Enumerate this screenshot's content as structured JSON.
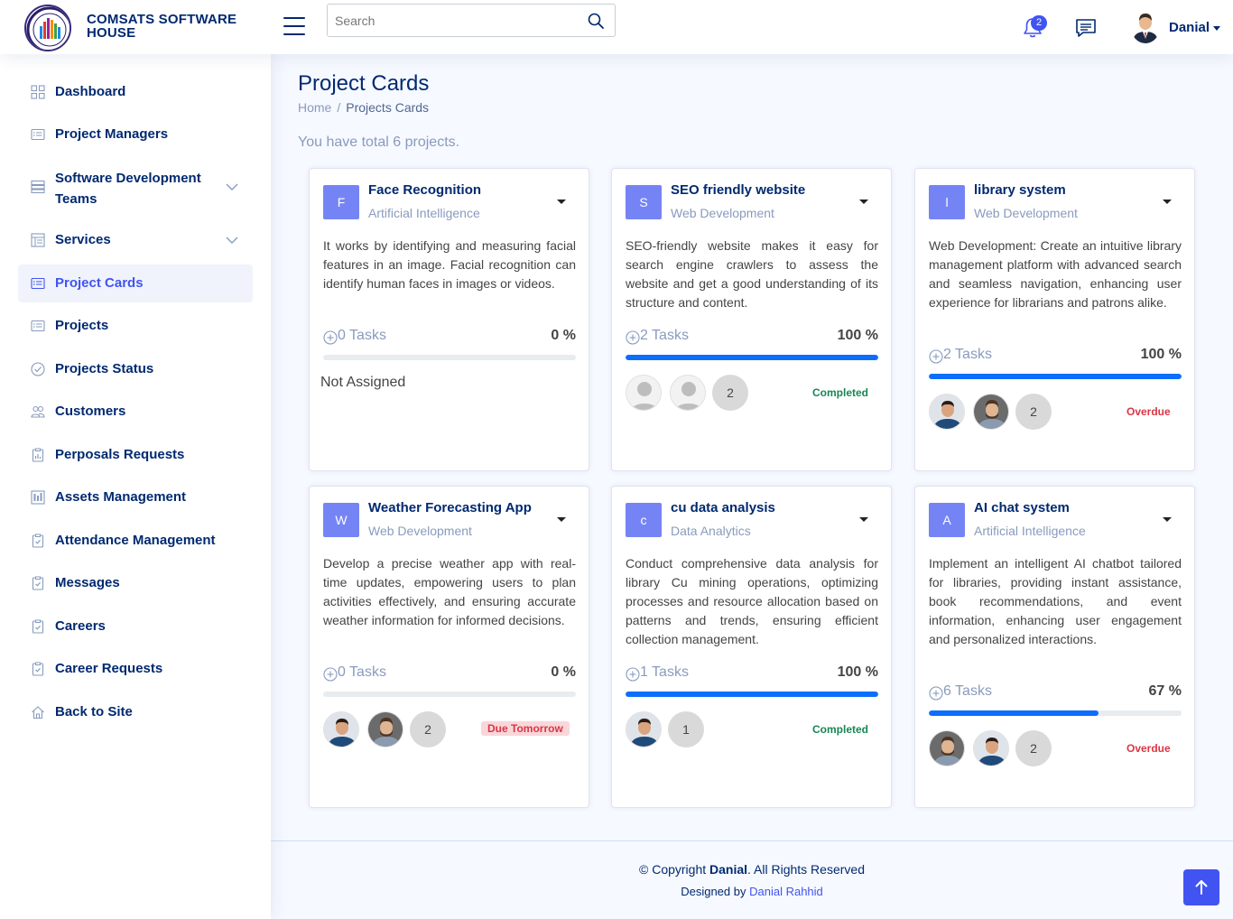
{
  "header": {
    "brand_line1": "COMSATS SOFTWARE",
    "brand_line2": "HOUSE",
    "search_placeholder": "Search",
    "notification_count": "2",
    "user_name": "Danial"
  },
  "sidebar": {
    "items": [
      {
        "label": "Dashboard",
        "icon": "grid-icon"
      },
      {
        "label": "Project Managers",
        "icon": "card-list-icon"
      },
      {
        "label": "Software Development Teams",
        "icon": "layers-icon",
        "expandable": true
      },
      {
        "label": "Services",
        "icon": "layout-icon",
        "expandable": true
      },
      {
        "label": "Project Cards",
        "icon": "card-list-icon",
        "active": true
      },
      {
        "label": "Projects",
        "icon": "card-list-icon"
      },
      {
        "label": "Projects Status",
        "icon": "check-circle-icon"
      },
      {
        "label": "Customers",
        "icon": "people-icon"
      },
      {
        "label": "Perposals Requests",
        "icon": "clipboard-data-icon"
      },
      {
        "label": "Assets Management",
        "icon": "bar-chart-icon"
      },
      {
        "label": "Attendance Management",
        "icon": "clipboard-check-icon"
      },
      {
        "label": "Messages",
        "icon": "clipboard-check-icon"
      },
      {
        "label": "Careers",
        "icon": "clipboard-check-icon"
      },
      {
        "label": "Career Requests",
        "icon": "clipboard-check-icon"
      },
      {
        "label": "Back to Site",
        "icon": "house-icon"
      }
    ]
  },
  "main": {
    "title": "Project Cards",
    "breadcrumb_home": "Home",
    "breadcrumb_sep": "/",
    "breadcrumb_current": "Projects Cards",
    "summary": "You have total 6 projects."
  },
  "projects": [
    {
      "initial": "F",
      "title": "Face Recognition",
      "category": "Artificial Intelligence",
      "description": "It works by identifying and measuring facial features in an image. Facial recognition can identify human faces in images or videos.",
      "tasks": "0 Tasks",
      "percent": "0 %",
      "progress": 0,
      "unassigned_text": "Not Assigned"
    },
    {
      "initial": "S",
      "title": "SEO friendly website",
      "category": "Web Development",
      "description": "SEO-friendly website makes it easy for search engine crawlers to assess the website and get a good understanding of its structure and content.",
      "tasks": "2 Tasks",
      "percent": "100 %",
      "progress": 100,
      "member_count": "2",
      "status": "Completed"
    },
    {
      "initial": "l",
      "title": "library system",
      "category": "Web Development",
      "description": "Web Development: Create an intuitive library management platform with advanced search and seamless navigation, enhancing user experience for librarians and patrons alike.",
      "tasks": "2 Tasks",
      "percent": "100 %",
      "progress": 100,
      "member_count": "2",
      "status": "Overdue"
    },
    {
      "initial": "W",
      "title": "Weather Forecasting App",
      "category": "Web Development",
      "description": "Develop a precise weather app with real-time updates, empowering users to plan activities effectively, and ensuring accurate weather information for informed decisions.",
      "tasks": "0 Tasks",
      "percent": "0 %",
      "progress": 0,
      "member_count": "2",
      "status": "Due Tomorrow"
    },
    {
      "initial": "c",
      "title": "cu data analysis",
      "category": "Data Analytics",
      "description": "Conduct comprehensive data analysis for library Cu mining operations, optimizing processes and resource allocation based on patterns and trends, ensuring efficient collection management.",
      "tasks": "1 Tasks",
      "percent": "100 %",
      "progress": 100,
      "member_count": "1",
      "status": "Completed"
    },
    {
      "initial": "A",
      "title": "AI chat system",
      "category": "Artificial Intelligence",
      "description": "Implement an intelligent AI chatbot tailored for libraries, providing instant assistance, book recommendations, and event information, enhancing user engagement and personalized interactions.",
      "tasks": "6 Tasks",
      "percent": "67 %",
      "progress": 67,
      "member_count": "2",
      "status": "Overdue"
    }
  ],
  "footer": {
    "copyright_prefix": "© Copyright ",
    "copyright_name": "Danial",
    "copyright_suffix": ". All Rights Reserved",
    "designed_prefix": "Designed by ",
    "designed_name": "Danial Rahhid"
  },
  "colors": {
    "primary": "#4154f1",
    "navy": "#012970",
    "initial_bg": "#7584f5",
    "progress": "#0d6efd",
    "success": "#198754",
    "danger": "#dc3545"
  }
}
